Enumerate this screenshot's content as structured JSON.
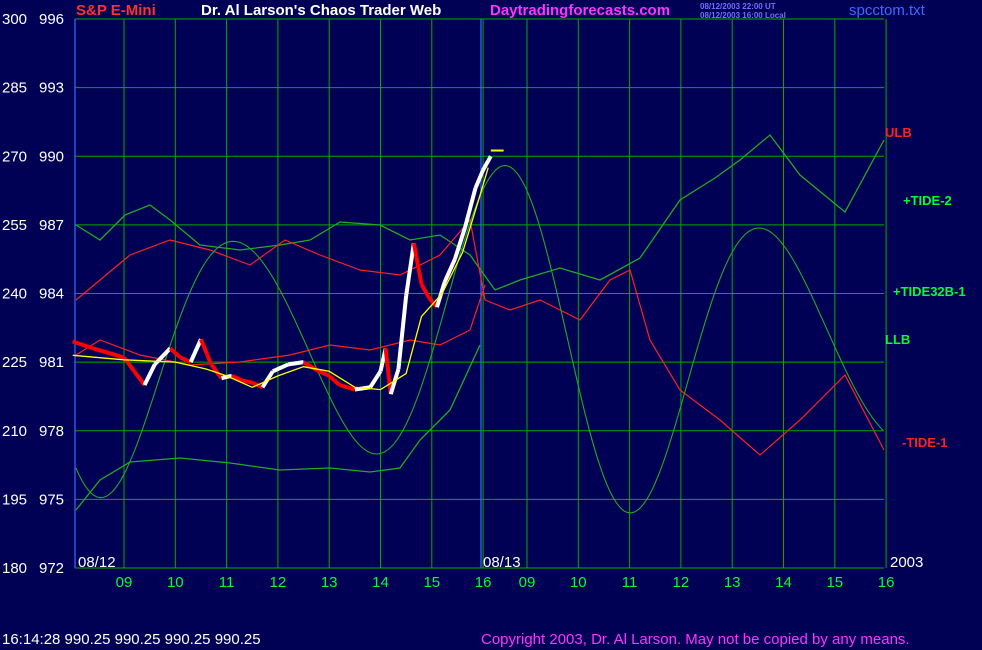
{
  "header": {
    "instrument": "S&P E-Mini",
    "title": "Dr. Al Larson's Chaos Trader Web",
    "site": "Daytradingforecasts.com",
    "stamp_line1": "08/12/2003 22:00 UT",
    "stamp_line2": "08/12/2003 16:00 Local",
    "filename": "spcctom.txt"
  },
  "footer": {
    "quote": "16:14:28  990.25 990.25 990.25 990.25",
    "copyright": "Copyright 2003, Dr. Al Larson. May not be copied by any means."
  },
  "colors": {
    "background": "#000055",
    "grid": "#00aa00",
    "header_red": "#ff3030",
    "header_magenta": "#ff33ff",
    "header_blue": "#3a6bff",
    "ulb": "#ff2020",
    "llb": "#00ff33",
    "tide": "#22aa22",
    "price_up": "#ffffff",
    "price_down": "#ff0000",
    "average": "#ffff00"
  },
  "chart_data": {
    "type": "line",
    "title": "S&P E-Mini",
    "y_left_labels": [
      "300",
      "285",
      "270",
      "255",
      "240",
      "225",
      "210",
      "195",
      "180"
    ],
    "y_right_labels": [
      "996",
      "993",
      "990",
      "987",
      "984",
      "981",
      "978",
      "975",
      "972"
    ],
    "ylim": [
      972,
      996
    ],
    "x_tick_labels": [
      "09",
      "10",
      "11",
      "12",
      "13",
      "14",
      "15",
      "16",
      "09",
      "10",
      "11",
      "12",
      "13",
      "14",
      "15",
      "16"
    ],
    "date_labels": [
      "08/12",
      "08/13",
      "2003"
    ],
    "series_labels": [
      "ULB",
      "+TIDE-2",
      "+TIDE32B-1",
      "LLB",
      "-TIDE-1"
    ],
    "price_path": [
      [
        8.0,
        981.9
      ],
      [
        8.4,
        981.6
      ],
      [
        8.7,
        981.4
      ],
      [
        9.0,
        981.2
      ],
      [
        9.2,
        980.6
      ],
      [
        9.4,
        980.0
      ],
      [
        9.6,
        980.9
      ],
      [
        9.9,
        981.6
      ],
      [
        10.1,
        981.2
      ],
      [
        10.3,
        981.0
      ],
      [
        10.5,
        982.0
      ],
      [
        10.7,
        980.9
      ],
      [
        10.9,
        980.3
      ],
      [
        11.1,
        980.4
      ],
      [
        11.3,
        980.2
      ],
      [
        11.5,
        980.1
      ],
      [
        11.7,
        979.9
      ],
      [
        11.9,
        980.6
      ],
      [
        12.2,
        980.9
      ],
      [
        12.5,
        981.0
      ],
      [
        12.8,
        980.6
      ],
      [
        13.0,
        980.4
      ],
      [
        13.2,
        980.0
      ],
      [
        13.5,
        979.8
      ],
      [
        13.8,
        979.9
      ],
      [
        14.0,
        980.6
      ],
      [
        14.1,
        981.6
      ],
      [
        14.2,
        979.6
      ],
      [
        14.35,
        980.7
      ],
      [
        14.5,
        983.9
      ],
      [
        14.65,
        986.2
      ],
      [
        14.8,
        984.4
      ],
      [
        14.95,
        983.8
      ],
      [
        15.1,
        983.4
      ],
      [
        15.25,
        984.5
      ],
      [
        15.45,
        985.5
      ],
      [
        15.65,
        986.9
      ],
      [
        15.85,
        988.6
      ],
      [
        16.0,
        989.4
      ],
      [
        16.1,
        989.8
      ],
      [
        16.15,
        990.0
      ]
    ],
    "flat_bar": [
      16.15,
      16.4,
      990.25
    ],
    "average_path": [
      [
        8.0,
        981.3
      ],
      [
        9.0,
        981.1
      ],
      [
        10.0,
        981.0
      ],
      [
        10.6,
        980.7
      ],
      [
        11.0,
        980.4
      ],
      [
        11.5,
        979.9
      ],
      [
        12.0,
        980.4
      ],
      [
        12.5,
        980.8
      ],
      [
        13.0,
        980.6
      ],
      [
        13.5,
        979.9
      ],
      [
        14.0,
        979.8
      ],
      [
        14.5,
        980.5
      ],
      [
        14.8,
        983.0
      ],
      [
        15.2,
        984.0
      ],
      [
        15.6,
        985.8
      ],
      [
        15.9,
        988.0
      ],
      [
        16.1,
        989.5
      ]
    ]
  }
}
